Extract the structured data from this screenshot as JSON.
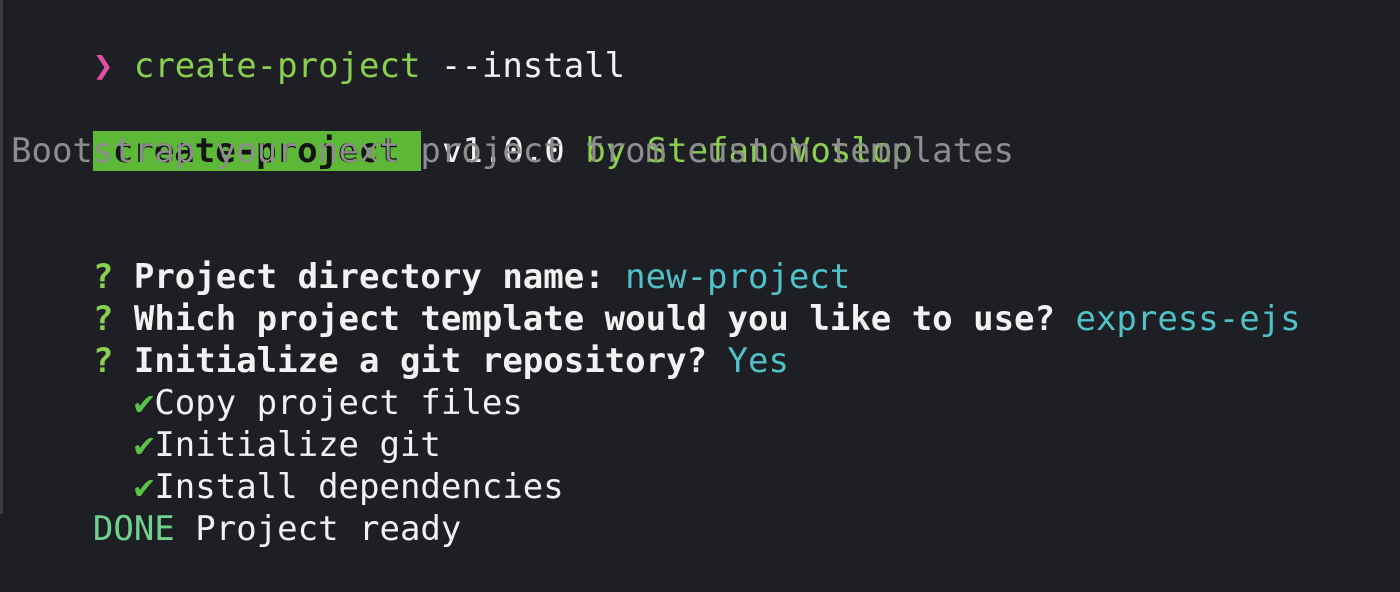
{
  "terminal": {
    "prompt_symbol": "❯",
    "command": "create-project",
    "command_args": "--install",
    "banner": {
      "badge": "create-project",
      "version": "v1.0.0",
      "byline": "by Stefan Vosloo"
    },
    "tagline": "Bootstrap your next project from custom templates",
    "questions": [
      {
        "mark": "?",
        "prompt": "Project directory name:",
        "answer": "new-project"
      },
      {
        "mark": "?",
        "prompt": "Which project template would you like to use?",
        "answer": "express-ejs"
      },
      {
        "mark": "?",
        "prompt": "Initialize a git repository?",
        "answer": "Yes"
      }
    ],
    "tasks": [
      {
        "icon": "✔",
        "label": "Copy project files"
      },
      {
        "icon": "✔",
        "label": "Initialize git"
      },
      {
        "icon": "✔",
        "label": "Install dependencies"
      }
    ],
    "done": {
      "tag": "DONE",
      "message": "Project ready"
    }
  },
  "colors": {
    "background": "#1e1f24",
    "prompt_arrow": "#e34fa3",
    "command": "#8bcf4f",
    "badge_bg": "#5db838",
    "answer": "#4fc1c7",
    "tagline": "#8d8d8d",
    "done": "#6fd38f"
  }
}
